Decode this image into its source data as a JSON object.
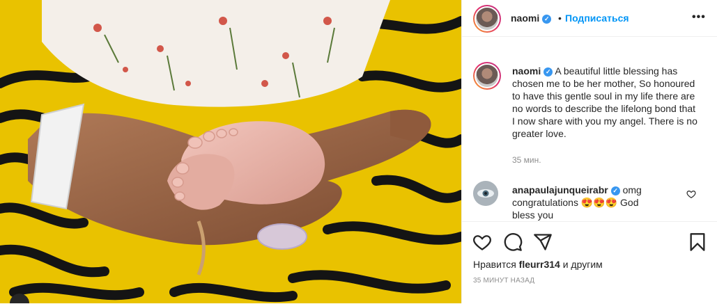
{
  "post": {
    "image_alt": "Mother's hand holding a newborn baby's feet on a yellow and black patterned fabric",
    "accent_color": "#0095f6"
  },
  "header": {
    "username": "naomi",
    "verified_mark": "✓",
    "separator": "•",
    "follow_label": "Подписаться",
    "more_label": "•••"
  },
  "caption": {
    "username": "naomi",
    "text": "A beautiful little blessing has chosen me to be her mother, So honoured to have this gentle soul in my life there are no words to describe the lifelong bond that I now share with you my angel. There is no greater love.",
    "time": "35 мин."
  },
  "comments": [
    {
      "username": "anapaulajunqueirabr",
      "text": "omg congratulations 😍😍😍 God bless you"
    }
  ],
  "likes": {
    "prefix": "Нравится",
    "user": "fleurr314",
    "suffix": "и другим"
  },
  "post_time": "35 минут назад",
  "icons": [
    "heart-icon",
    "comment-icon",
    "share-icon",
    "bookmark-icon",
    "more-icon",
    "verified-icon"
  ]
}
